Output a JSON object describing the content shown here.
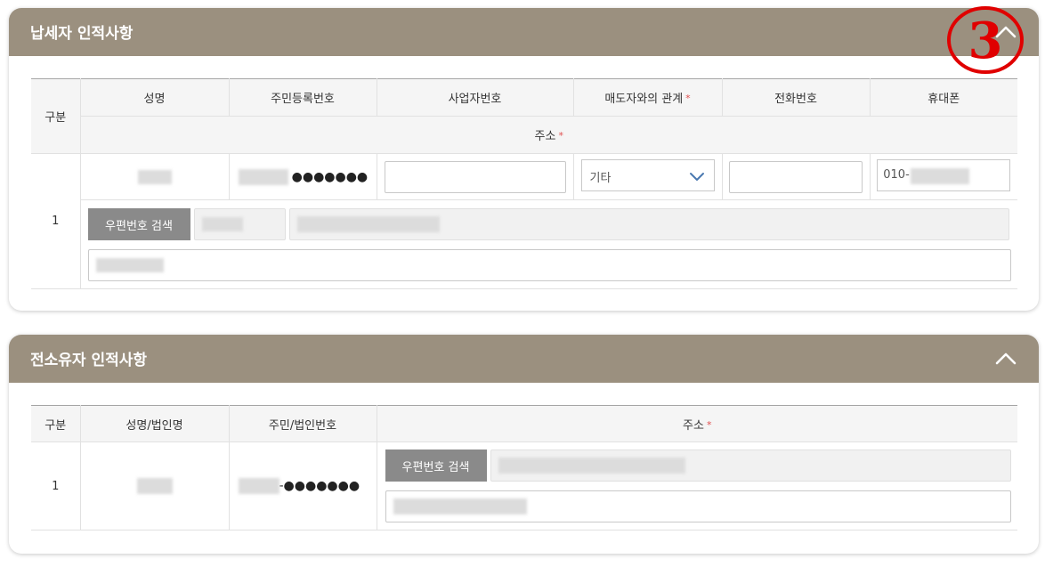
{
  "marker": {
    "label": "③",
    "color": "#e00000"
  },
  "panel1": {
    "title": "납세자 인적사항",
    "headers": {
      "gubun": "구분",
      "name": "성명",
      "rrn": "주민등록번호",
      "bizno": "사업자번호",
      "relation": "매도자와의 관계",
      "tel": "전화번호",
      "mobile": "휴대폰",
      "address": "주소"
    },
    "required_mark": "*",
    "row": {
      "index": "1",
      "rrn_masked": "●●●●●●●",
      "bizno_value": "",
      "relation_selected": "기타",
      "tel_value": "",
      "mobile_prefix": "010-",
      "zip_button": "우편번호 검색"
    }
  },
  "panel2": {
    "title": "전소유자 인적사항",
    "headers": {
      "gubun": "구분",
      "name": "성명/법인명",
      "id": "주민/법인번호",
      "address": "주소"
    },
    "required_mark": "*",
    "row": {
      "index": "1",
      "id_masked": "-●●●●●●●",
      "zip_button": "우편번호 검색"
    }
  },
  "colors": {
    "header_bg": "#9b907f",
    "required": "#e05050",
    "button_gray": "#8a8a8a",
    "select_arrow": "#4a78b0"
  }
}
